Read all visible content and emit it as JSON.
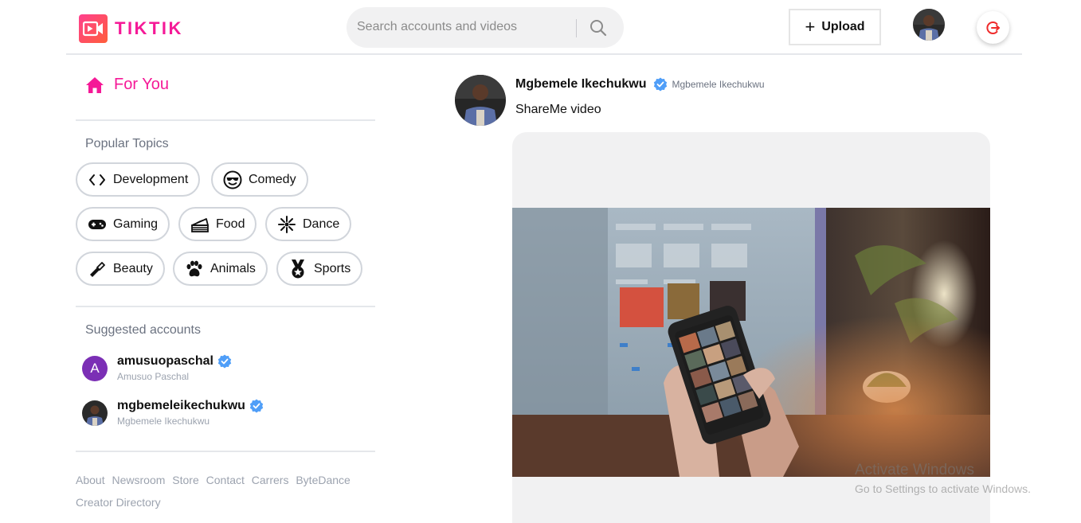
{
  "brand": {
    "name": "TIKTIK",
    "color": "#f51997"
  },
  "search": {
    "placeholder": "Search accounts and videos",
    "icon": "search-icon"
  },
  "header": {
    "upload_label": "Upload",
    "upload_icon": "plus-icon",
    "logout_icon": "logout-icon",
    "logout_color": "#ef2b2b"
  },
  "sidebar": {
    "for_you_label": "For You",
    "for_you_icon": "home-icon",
    "popular_topics_heading": "Popular Topics",
    "topics": [
      {
        "label": "Development",
        "icon": "code-icon"
      },
      {
        "label": "Comedy",
        "icon": "cool-face-icon"
      },
      {
        "label": "Gaming",
        "icon": "gamepad-icon"
      },
      {
        "label": "Food",
        "icon": "cake-icon"
      },
      {
        "label": "Dance",
        "icon": "dance-burst-icon"
      },
      {
        "label": "Beauty",
        "icon": "lipstick-icon"
      },
      {
        "label": "Animals",
        "icon": "paw-icon"
      },
      {
        "label": "Sports",
        "icon": "medal-icon"
      }
    ],
    "suggested_heading": "Suggested accounts",
    "accounts": [
      {
        "handle": "amusuopaschal",
        "name": "Amusuo Paschal",
        "avatar_letter": "A",
        "verified": true
      },
      {
        "handle": "mgbemeleikechukwu",
        "name": "Mgbemele Ikechukwu",
        "verified": true
      }
    ],
    "footer_links": [
      "About",
      "Newsroom",
      "Store",
      "Contact",
      "Carrers",
      "ByteDance",
      "Creator Directory"
    ]
  },
  "feed": {
    "posts": [
      {
        "author_name": "Mgbemele Ikechukwu",
        "author_sub": "Mgbemele Ikechukwu",
        "verified": true,
        "caption": "ShareMe video"
      }
    ]
  },
  "watermark": {
    "title": "Activate Windows",
    "subtitle": "Go to Settings to activate Windows."
  },
  "colors": {
    "accent": "#f51997",
    "verified": "#4f9ef8",
    "divider": "#e5e7eb"
  }
}
